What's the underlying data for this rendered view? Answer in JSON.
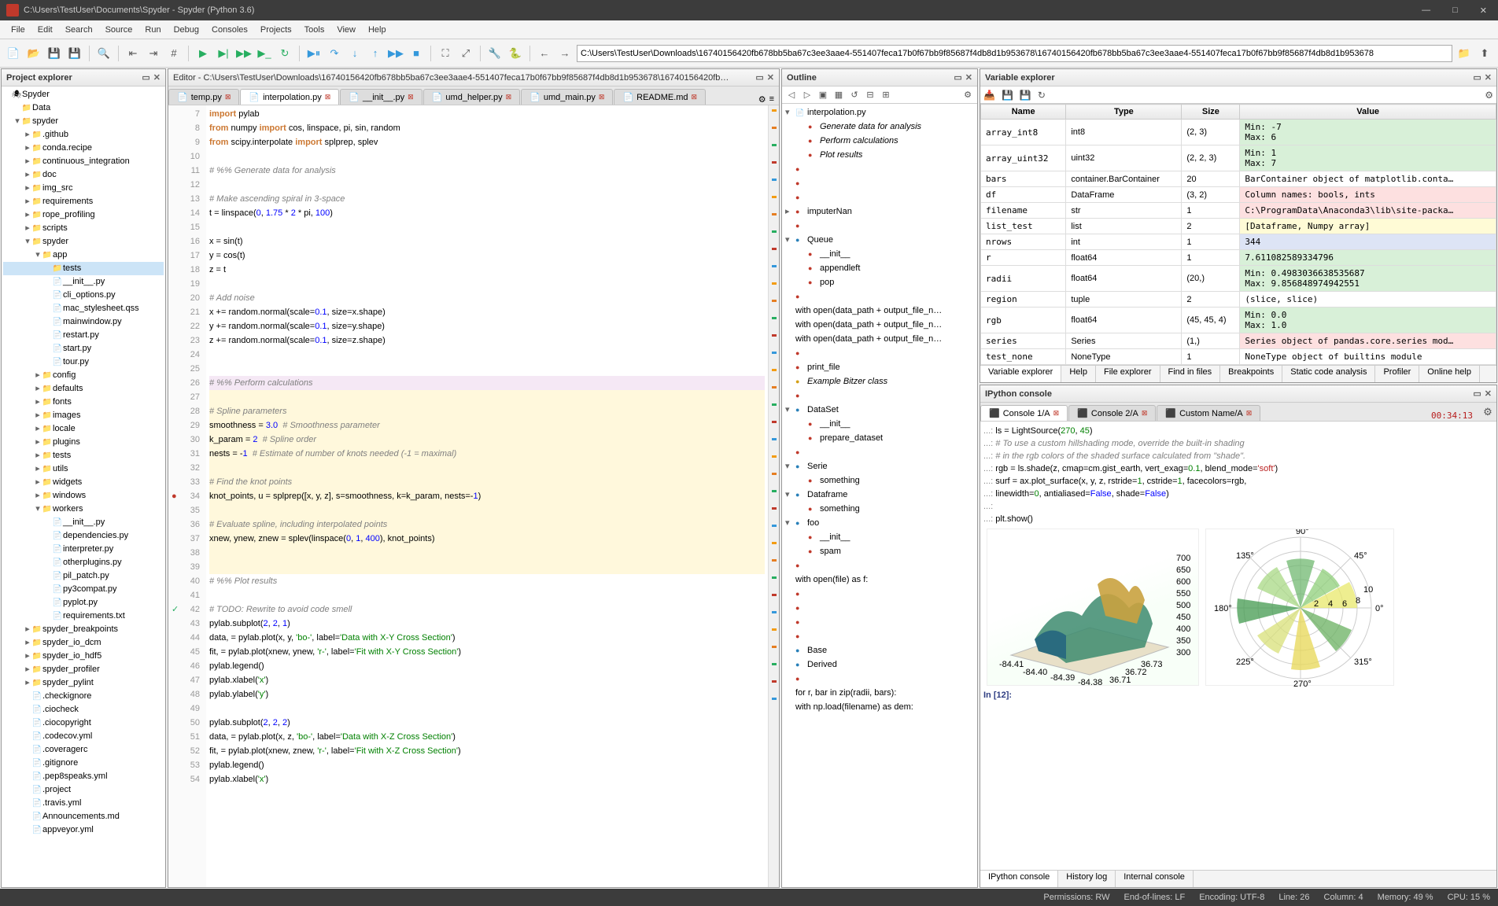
{
  "window": {
    "title": "C:\\Users\\TestUser\\Documents\\Spyder - Spyder (Python 3.6)"
  },
  "menubar": [
    "File",
    "Edit",
    "Search",
    "Source",
    "Run",
    "Debug",
    "Consoles",
    "Projects",
    "Tools",
    "View",
    "Help"
  ],
  "address": "C:\\Users\\TestUser\\Downloads\\16740156420fb678bb5ba67c3ee3aae4-551407feca17b0f67bb9f85687f4db8d1b953678\\16740156420fb678bb5ba67c3ee3aae4-551407feca17b0f67bb9f85687f4db8d1b953678",
  "panes": {
    "project": "Project explorer",
    "editor": "Editor - C:\\Users\\TestUser\\Downloads\\16740156420fb678bb5ba67c3ee3aae4-551407feca17b0f67bb9f85687f4db8d1b953678\\16740156420fb…",
    "outline": "Outline",
    "varexp": "Variable explorer",
    "ipy": "IPython console"
  },
  "project_tree": [
    {
      "d": 0,
      "t": "root",
      "n": "Spyder"
    },
    {
      "d": 1,
      "t": "fld",
      "tw": "",
      "n": "Data"
    },
    {
      "d": 1,
      "t": "fld",
      "tw": "▾",
      "n": "spyder"
    },
    {
      "d": 2,
      "t": "fld",
      "tw": "▸",
      "n": ".github"
    },
    {
      "d": 2,
      "t": "fld",
      "tw": "▸",
      "n": "conda.recipe"
    },
    {
      "d": 2,
      "t": "fld",
      "tw": "▸",
      "n": "continuous_integration"
    },
    {
      "d": 2,
      "t": "fld",
      "tw": "▸",
      "n": "doc"
    },
    {
      "d": 2,
      "t": "fld",
      "tw": "▸",
      "n": "img_src"
    },
    {
      "d": 2,
      "t": "fld",
      "tw": "▸",
      "n": "requirements"
    },
    {
      "d": 2,
      "t": "fld",
      "tw": "▸",
      "n": "rope_profiling"
    },
    {
      "d": 2,
      "t": "fld",
      "tw": "▸",
      "n": "scripts"
    },
    {
      "d": 2,
      "t": "fld",
      "tw": "▾",
      "n": "spyder"
    },
    {
      "d": 3,
      "t": "fld",
      "tw": "▾",
      "n": "app"
    },
    {
      "d": 4,
      "t": "fld",
      "tw": "",
      "n": "tests",
      "sel": true
    },
    {
      "d": 4,
      "t": "py",
      "n": "__init__.py"
    },
    {
      "d": 4,
      "t": "py",
      "n": "cli_options.py"
    },
    {
      "d": 4,
      "t": "fl",
      "n": "mac_stylesheet.qss"
    },
    {
      "d": 4,
      "t": "py",
      "n": "mainwindow.py"
    },
    {
      "d": 4,
      "t": "py",
      "n": "restart.py"
    },
    {
      "d": 4,
      "t": "py",
      "n": "start.py"
    },
    {
      "d": 4,
      "t": "py",
      "n": "tour.py"
    },
    {
      "d": 3,
      "t": "fld",
      "tw": "▸",
      "n": "config"
    },
    {
      "d": 3,
      "t": "fld",
      "tw": "▸",
      "n": "defaults"
    },
    {
      "d": 3,
      "t": "fld",
      "tw": "▸",
      "n": "fonts"
    },
    {
      "d": 3,
      "t": "fld",
      "tw": "▸",
      "n": "images"
    },
    {
      "d": 3,
      "t": "fld",
      "tw": "▸",
      "n": "locale"
    },
    {
      "d": 3,
      "t": "fld",
      "tw": "▸",
      "n": "plugins"
    },
    {
      "d": 3,
      "t": "fld",
      "tw": "▸",
      "n": "tests"
    },
    {
      "d": 3,
      "t": "fld",
      "tw": "▸",
      "n": "utils"
    },
    {
      "d": 3,
      "t": "fld",
      "tw": "▸",
      "n": "widgets"
    },
    {
      "d": 3,
      "t": "fld",
      "tw": "▸",
      "n": "windows"
    },
    {
      "d": 3,
      "t": "fld",
      "tw": "▾",
      "n": "workers"
    },
    {
      "d": 4,
      "t": "py",
      "n": "__init__.py"
    },
    {
      "d": 4,
      "t": "py",
      "n": "dependencies.py"
    },
    {
      "d": 4,
      "t": "py",
      "n": "interpreter.py"
    },
    {
      "d": 4,
      "t": "py",
      "n": "otherplugins.py"
    },
    {
      "d": 4,
      "t": "py",
      "n": "pil_patch.py"
    },
    {
      "d": 4,
      "t": "py",
      "n": "py3compat.py"
    },
    {
      "d": 4,
      "t": "py",
      "n": "pyplot.py"
    },
    {
      "d": 4,
      "t": "fl",
      "n": "requirements.txt"
    },
    {
      "d": 2,
      "t": "fld",
      "tw": "▸",
      "n": "spyder_breakpoints"
    },
    {
      "d": 2,
      "t": "fld",
      "tw": "▸",
      "n": "spyder_io_dcm"
    },
    {
      "d": 2,
      "t": "fld",
      "tw": "▸",
      "n": "spyder_io_hdf5"
    },
    {
      "d": 2,
      "t": "fld",
      "tw": "▸",
      "n": "spyder_profiler"
    },
    {
      "d": 2,
      "t": "fld",
      "tw": "▸",
      "n": "spyder_pylint"
    },
    {
      "d": 2,
      "t": "fl",
      "n": ".checkignore"
    },
    {
      "d": 2,
      "t": "fl",
      "n": ".ciocheck"
    },
    {
      "d": 2,
      "t": "fl",
      "n": ".ciocopyright"
    },
    {
      "d": 2,
      "t": "fl",
      "n": ".codecov.yml"
    },
    {
      "d": 2,
      "t": "fl",
      "n": ".coveragerc"
    },
    {
      "d": 2,
      "t": "fl",
      "n": ".gitignore"
    },
    {
      "d": 2,
      "t": "fl",
      "n": ".pep8speaks.yml"
    },
    {
      "d": 2,
      "t": "fl",
      "n": ".project"
    },
    {
      "d": 2,
      "t": "fl",
      "n": ".travis.yml"
    },
    {
      "d": 2,
      "t": "fl",
      "n": "Announcements.md"
    },
    {
      "d": 2,
      "t": "fl",
      "n": "appveyor.yml"
    }
  ],
  "editor_tabs": [
    {
      "name": "temp.py",
      "active": false
    },
    {
      "name": "interpolation.py",
      "active": true
    },
    {
      "name": "__init__.py",
      "active": false
    },
    {
      "name": "umd_helper.py",
      "active": false
    },
    {
      "name": "umd_main.py",
      "active": false
    },
    {
      "name": "README.md",
      "active": false
    }
  ],
  "code_lines": [
    {
      "n": 7,
      "h": "<span class='kw'>import</span> pylab"
    },
    {
      "n": 8,
      "h": "<span class='kw'>from</span> numpy <span class='kw'>import</span> cos, linspace, pi, sin, random"
    },
    {
      "n": 9,
      "h": "<span class='kw'>from</span> scipy.interpolate <span class='kw'>import</span> splprep, splev"
    },
    {
      "n": 10,
      "h": ""
    },
    {
      "n": 11,
      "h": "<span class='c'># %% Generate data for analysis</span>",
      "cell": true
    },
    {
      "n": 12,
      "h": ""
    },
    {
      "n": 13,
      "h": "<span class='c'># Make ascending spiral in 3-space</span>"
    },
    {
      "n": 14,
      "h": "t = linspace(<span class='n'>0</span>, <span class='n'>1.75</span> * <span class='n'>2</span> * pi, <span class='n'>100</span>)"
    },
    {
      "n": 15,
      "h": ""
    },
    {
      "n": 16,
      "h": "x = sin(t)"
    },
    {
      "n": 17,
      "h": "y = cos(t)"
    },
    {
      "n": 18,
      "h": "z = t"
    },
    {
      "n": 19,
      "h": ""
    },
    {
      "n": 20,
      "h": "<span class='c'># Add noise</span>"
    },
    {
      "n": 21,
      "h": "x += random.normal(scale=<span class='n'>0.1</span>, size=x.shape)"
    },
    {
      "n": 22,
      "h": "y += random.normal(scale=<span class='n'>0.1</span>, size=y.shape)"
    },
    {
      "n": 23,
      "h": "z += random.normal(scale=<span class='n'>0.1</span>, size=z.shape)"
    },
    {
      "n": 24,
      "h": ""
    },
    {
      "n": 25,
      "h": ""
    },
    {
      "n": 26,
      "h": "<span class='c'># %% Perform calculations</span>",
      "cur": true
    },
    {
      "n": 27,
      "h": "",
      "hl": true
    },
    {
      "n": 28,
      "h": "<span class='c'># Spline parameters</span>",
      "hl": true
    },
    {
      "n": 29,
      "h": "smoothness = <span class='n'>3.0</span>  <span class='c'># Smoothness parameter</span>",
      "hl": true
    },
    {
      "n": 30,
      "h": "k_param = <span class='n'>2</span>  <span class='c'># Spline order</span>",
      "hl": true
    },
    {
      "n": 31,
      "h": "nests = -<span class='n'>1</span>  <span class='c'># Estimate of number of knots needed (-1 = maximal)</span>",
      "hl": true
    },
    {
      "n": 32,
      "h": "",
      "hl": true
    },
    {
      "n": 33,
      "h": "<span class='c'># Find the knot points</span>",
      "hl": true
    },
    {
      "n": 34,
      "h": "knot_points, u = splprep([x, y, z], s=smoothness, k=k_param, nests=-<span class='n'>1</span>)",
      "hl": true,
      "bp": true
    },
    {
      "n": 35,
      "h": "",
      "hl": true
    },
    {
      "n": 36,
      "h": "<span class='c'># Evaluate spline, including interpolated points</span>",
      "hl": true
    },
    {
      "n": 37,
      "h": "xnew, ynew, znew = splev(linspace(<span class='n'>0</span>, <span class='n'>1</span>, <span class='n'>400</span>), knot_points)",
      "hl": true
    },
    {
      "n": 38,
      "h": "",
      "hl": true
    },
    {
      "n": 39,
      "h": "",
      "hl": true
    },
    {
      "n": 40,
      "h": "<span class='c'># %% Plot results</span>",
      "cell": true
    },
    {
      "n": 41,
      "h": ""
    },
    {
      "n": 42,
      "h": "<span class='c'># TODO: Rewrite to avoid code smell</span>",
      "chk": true
    },
    {
      "n": 43,
      "h": "pylab.subplot(<span class='n'>2</span>, <span class='n'>2</span>, <span class='n'>1</span>)"
    },
    {
      "n": 44,
      "h": "data, = pylab.plot(x, y, <span class='s'>'bo-'</span>, label=<span class='s'>'Data with X-Y Cross Section'</span>)"
    },
    {
      "n": 45,
      "h": "fit, = pylab.plot(xnew, ynew, <span class='s'>'r-'</span>, label=<span class='s'>'Fit with X-Y Cross Section'</span>)"
    },
    {
      "n": 46,
      "h": "pylab.legend()"
    },
    {
      "n": 47,
      "h": "pylab.xlabel(<span class='s'>'x'</span>)"
    },
    {
      "n": 48,
      "h": "pylab.ylabel(<span class='s'>'y'</span>)"
    },
    {
      "n": 49,
      "h": ""
    },
    {
      "n": 50,
      "h": "pylab.subplot(<span class='n'>2</span>, <span class='n'>2</span>, <span class='n'>2</span>)"
    },
    {
      "n": 51,
      "h": "data, = pylab.plot(x, z, <span class='s'>'bo-'</span>, label=<span class='s'>'Data with X-Z Cross Section'</span>)"
    },
    {
      "n": 52,
      "h": "fit, = pylab.plot(xnew, znew, <span class='s'>'r-'</span>, label=<span class='s'>'Fit with X-Z Cross Section'</span>)"
    },
    {
      "n": 53,
      "h": "pylab.legend()"
    },
    {
      "n": 54,
      "h": "pylab.xlabel(<span class='s'>'x'</span>)"
    }
  ],
  "outline": [
    {
      "d": 0,
      "tw": "▾",
      "ic": "py",
      "n": "interpolation.py"
    },
    {
      "d": 1,
      "ic": "red",
      "n": "Generate data for analysis",
      "it": true
    },
    {
      "d": 1,
      "ic": "red",
      "n": "Perform calculations",
      "it": true
    },
    {
      "d": 1,
      "ic": "red",
      "n": "Plot results",
      "it": true
    },
    {
      "d": 0,
      "ic": "red",
      "n": ""
    },
    {
      "d": 0,
      "ic": "red",
      "n": ""
    },
    {
      "d": 0,
      "ic": "red",
      "n": ""
    },
    {
      "d": 0,
      "tw": "▸",
      "ic": "red",
      "n": "imputerNan"
    },
    {
      "d": 0,
      "ic": "red",
      "n": ""
    },
    {
      "d": 0,
      "tw": "▾",
      "ic": "blue",
      "n": "Queue"
    },
    {
      "d": 1,
      "ic": "red",
      "n": "__init__"
    },
    {
      "d": 1,
      "ic": "red",
      "n": "appendleft"
    },
    {
      "d": 1,
      "ic": "red",
      "n": "pop"
    },
    {
      "d": 0,
      "ic": "red",
      "n": ""
    },
    {
      "d": 0,
      "ic": "",
      "n": "with open(data_path + output_file_n…"
    },
    {
      "d": 0,
      "ic": "",
      "n": "with open(data_path + output_file_n…"
    },
    {
      "d": 0,
      "ic": "",
      "n": "with open(data_path + output_file_n…"
    },
    {
      "d": 0,
      "ic": "red",
      "n": ""
    },
    {
      "d": 0,
      "ic": "red",
      "n": "print_file"
    },
    {
      "d": 0,
      "ic": "yel",
      "n": "Example Bitzer class",
      "it": true
    },
    {
      "d": 0,
      "ic": "red",
      "n": ""
    },
    {
      "d": 0,
      "tw": "▾",
      "ic": "blue",
      "n": "DataSet"
    },
    {
      "d": 1,
      "ic": "red",
      "n": "__init__"
    },
    {
      "d": 1,
      "ic": "red",
      "n": "prepare_dataset"
    },
    {
      "d": 0,
      "ic": "red",
      "n": ""
    },
    {
      "d": 0,
      "tw": "▾",
      "ic": "blue",
      "n": "Serie"
    },
    {
      "d": 1,
      "ic": "red",
      "n": "something"
    },
    {
      "d": 0,
      "tw": "▾",
      "ic": "blue",
      "n": "Dataframe"
    },
    {
      "d": 1,
      "ic": "red",
      "n": "something"
    },
    {
      "d": 0,
      "tw": "▾",
      "ic": "blue",
      "n": "foo"
    },
    {
      "d": 1,
      "ic": "red",
      "n": "__init__"
    },
    {
      "d": 1,
      "ic": "red",
      "n": "spam"
    },
    {
      "d": 0,
      "ic": "red",
      "n": ""
    },
    {
      "d": 0,
      "ic": "",
      "n": "with open(file) as f:"
    },
    {
      "d": 0,
      "ic": "red",
      "n": ""
    },
    {
      "d": 0,
      "ic": "red",
      "n": ""
    },
    {
      "d": 0,
      "ic": "red",
      "n": ""
    },
    {
      "d": 0,
      "ic": "red",
      "n": ""
    },
    {
      "d": 0,
      "ic": "blue",
      "n": "Base"
    },
    {
      "d": 0,
      "ic": "blue",
      "n": "Derived"
    },
    {
      "d": 0,
      "ic": "red",
      "n": ""
    },
    {
      "d": 0,
      "ic": "",
      "n": "for r, bar in zip(radii, bars):"
    },
    {
      "d": 0,
      "ic": "",
      "n": "with np.load(filename) as dem:"
    }
  ],
  "var_headers": [
    "Name",
    "Type",
    "Size",
    "Value"
  ],
  "variables": [
    {
      "name": "array_int8",
      "type": "int8",
      "size": "(2, 3)",
      "value": "Min: -7\nMax: 6",
      "bg": "#d8f0d8"
    },
    {
      "name": "array_uint32",
      "type": "uint32",
      "size": "(2, 2, 3)",
      "value": "Min: 1\nMax: 7",
      "bg": "#d8f0d8"
    },
    {
      "name": "bars",
      "type": "container.BarContainer",
      "size": "20",
      "value": "BarContainer object of matplotlib.conta…",
      "bg": "#fff"
    },
    {
      "name": "df",
      "type": "DataFrame",
      "size": "(3, 2)",
      "value": "Column names: bools, ints",
      "bg": "#fde0e0"
    },
    {
      "name": "filename",
      "type": "str",
      "size": "1",
      "value": "C:\\ProgramData\\Anaconda3\\lib\\site-packa…",
      "bg": "#fde0e0"
    },
    {
      "name": "list_test",
      "type": "list",
      "size": "2",
      "value": "[Dataframe, Numpy array]",
      "bg": "#fffbd6"
    },
    {
      "name": "nrows",
      "type": "int",
      "size": "1",
      "value": "344",
      "bg": "#dde4f5"
    },
    {
      "name": "r",
      "type": "float64",
      "size": "1",
      "value": "7.611082589334796",
      "bg": "#d8f0d8"
    },
    {
      "name": "radii",
      "type": "float64",
      "size": "(20,)",
      "value": "Min: 0.4983036638535687\nMax: 9.856848974942551",
      "bg": "#d8f0d8"
    },
    {
      "name": "region",
      "type": "tuple",
      "size": "2",
      "value": "(slice, slice)",
      "bg": "#fff"
    },
    {
      "name": "rgb",
      "type": "float64",
      "size": "(45, 45, 4)",
      "value": "Min: 0.0\nMax: 1.0",
      "bg": "#d8f0d8"
    },
    {
      "name": "series",
      "type": "Series",
      "size": "(1,)",
      "value": "Series object of pandas.core.series mod…",
      "bg": "#fde0e0"
    },
    {
      "name": "test_none",
      "type": "NoneType",
      "size": "1",
      "value": "NoneType object of builtins module",
      "bg": "#fff"
    }
  ],
  "ve_tabs": [
    "Variable explorer",
    "Help",
    "File explorer",
    "Find in files",
    "Breakpoints",
    "Static code analysis",
    "Profiler",
    "Online help"
  ],
  "ipy_tabs": [
    {
      "name": "Console 1/A",
      "active": true
    },
    {
      "name": "Console 2/A",
      "active": false
    },
    {
      "name": "Custom Name/A",
      "active": false
    }
  ],
  "ipy_timer": "00:34:13",
  "ipy_prompt": "In [12]:",
  "bot_tabs": [
    "IPython console",
    "History log",
    "Internal console"
  ],
  "status": {
    "perm": "Permissions: RW",
    "eol": "End-of-lines: LF",
    "enc": "Encoding: UTF-8",
    "line": "Line: 26",
    "col": "Column: 4",
    "mem": "Memory: 49 %",
    "cpu": "CPU: 15 %"
  },
  "chart_data": [
    {
      "type": "surface3d",
      "title": "",
      "x_range": [
        -84.41,
        -84.38
      ],
      "y_range": [
        36.71,
        36.73
      ],
      "z_range": [
        300,
        700
      ],
      "z_ticks": [
        300,
        350,
        400,
        450,
        500,
        550,
        600,
        650,
        700
      ],
      "x_ticks": [
        -84.41,
        -84.4,
        -84.39,
        -84.38
      ],
      "y_ticks": [
        36.71,
        36.72,
        36.73
      ],
      "colormap": "gist_earth"
    },
    {
      "type": "polar_bar",
      "angle_ticks_deg": [
        0,
        45,
        90,
        135,
        180,
        225,
        270,
        315
      ],
      "radial_ticks": [
        2,
        4,
        6,
        8,
        10
      ],
      "n_bars": 20,
      "radii_min": 0.498,
      "radii_max": 9.857
    }
  ]
}
